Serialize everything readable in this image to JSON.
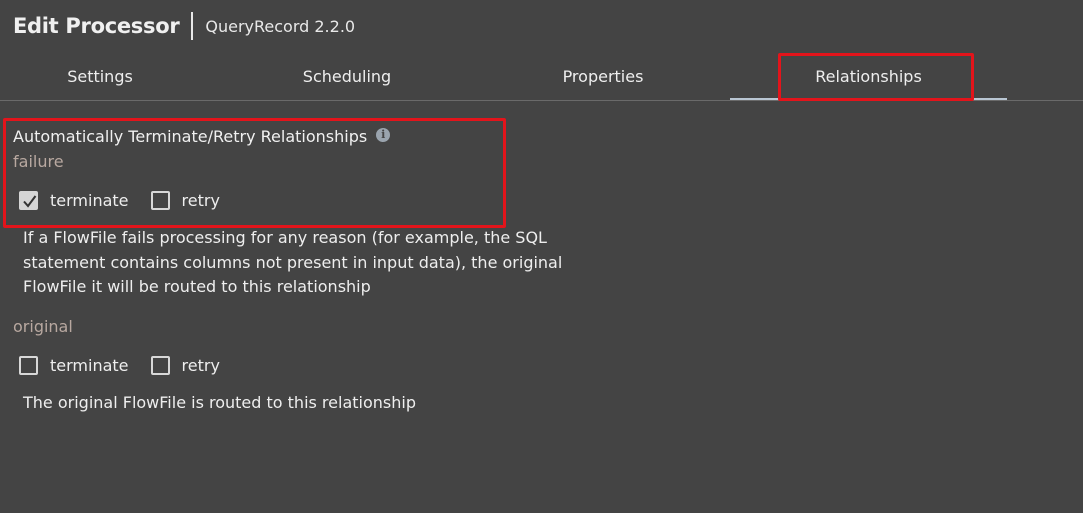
{
  "header": {
    "title": "Edit Processor",
    "subtitle": "QueryRecord 2.2.0"
  },
  "tabs": [
    {
      "label": "Settings",
      "active": false
    },
    {
      "label": "Scheduling",
      "active": false
    },
    {
      "label": "Properties",
      "active": false
    },
    {
      "label": "Relationships",
      "active": true
    }
  ],
  "section": {
    "heading": "Automatically Terminate/Retry Relationships",
    "info_icon": "info-icon"
  },
  "relationships": [
    {
      "name": "failure",
      "terminate_label": "terminate",
      "terminate_checked": true,
      "retry_label": "retry",
      "retry_checked": false,
      "description": [
        "If a FlowFile fails processing for any reason (for example, the SQL",
        "statement contains columns not present in input data), the original",
        "FlowFile it will be routed to this relationship"
      ]
    },
    {
      "name": "original",
      "terminate_label": "terminate",
      "terminate_checked": false,
      "retry_label": "retry",
      "retry_checked": false,
      "description": [
        "The original FlowFile is routed to this relationship"
      ]
    }
  ],
  "colors": {
    "background": "#444444",
    "highlight": "#e3141b",
    "active_tab_underline": "#b9c6d3",
    "relationship_name": "#b8a8a0"
  }
}
